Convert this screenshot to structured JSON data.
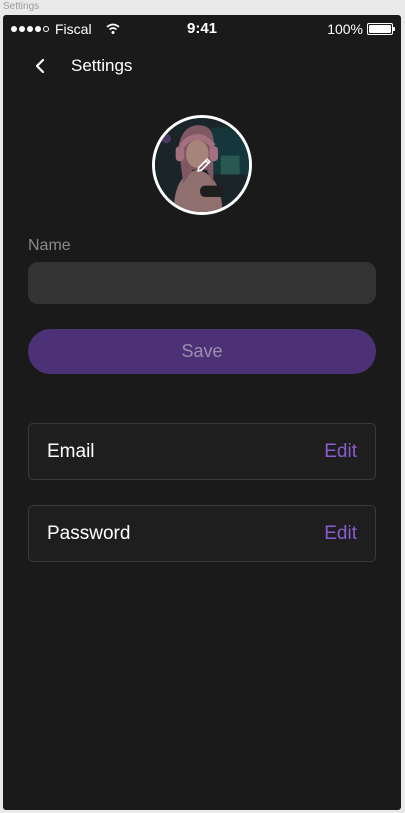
{
  "frame": {
    "label": "Settings"
  },
  "status_bar": {
    "carrier": "Fiscal",
    "time": "9:41",
    "battery": "100%",
    "signal_icon": "signal-dots-icon",
    "wifi_icon": "wifi-icon",
    "battery_icon": "battery-icon"
  },
  "header": {
    "back_icon": "chevron-left-icon",
    "title": "Settings"
  },
  "profile": {
    "avatar_icon": "avatar-photo",
    "edit_icon": "pencil-icon"
  },
  "form": {
    "name_label": "Name",
    "name_value": "",
    "save_label": "Save"
  },
  "account_rows": [
    {
      "label": "Email",
      "action": "Edit"
    },
    {
      "label": "Password",
      "action": "Edit"
    }
  ],
  "colors": {
    "background": "#1a1a1a",
    "input": "#333333",
    "save_button": "#4d3177",
    "accent": "#8c5ccf"
  }
}
